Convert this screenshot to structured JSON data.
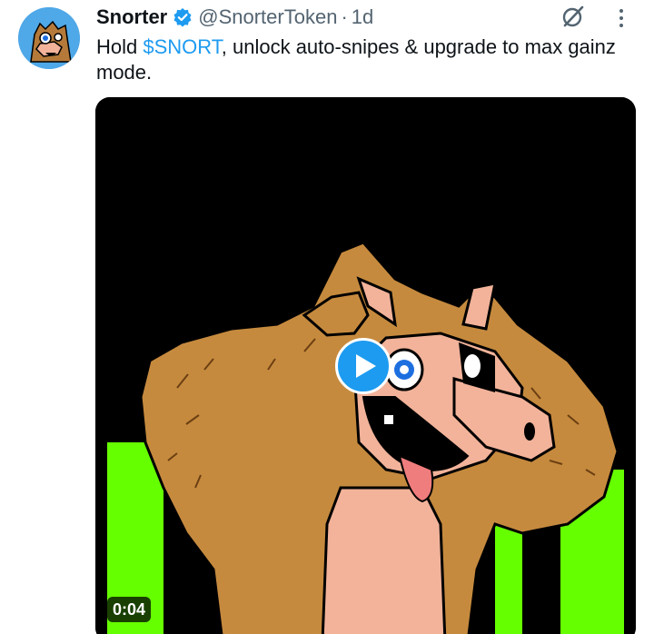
{
  "tweet": {
    "display_name": "Snorter",
    "handle": "@SnorterToken",
    "separator": "·",
    "time": "1d",
    "text_prefix": "Hold ",
    "cashtag": "$SNORT",
    "text_suffix": ", unlock auto-snipes & upgrade to max gainz mode."
  },
  "media": {
    "duration": "0:04"
  },
  "colors": {
    "link": "#1d9bf0",
    "verified": "#1d9bf0",
    "secondary_text": "#536471",
    "media_green": "#66ff00"
  },
  "icons": {
    "verified": "verified-badge-icon",
    "grok": "grok-icon",
    "more": "more-options-icon",
    "play": "play-icon"
  }
}
